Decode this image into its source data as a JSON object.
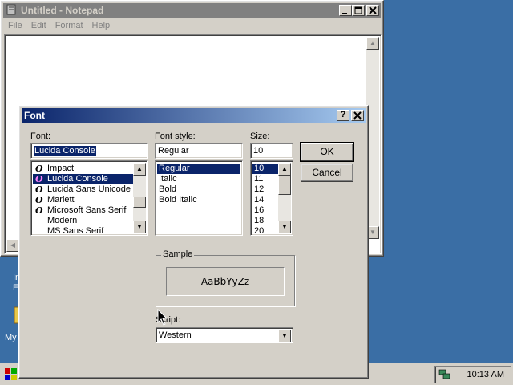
{
  "notepad": {
    "title": "Untitled - Notepad",
    "menu": [
      "File",
      "Edit",
      "Format",
      "Help"
    ]
  },
  "desktop": {
    "icon_label_1": "In",
    "icon_label_2": "Ex",
    "icon_label_3": "My"
  },
  "taskbar": {
    "clock": "10:13 AM"
  },
  "dialog": {
    "title": "Font",
    "help_button": "?",
    "close_button": "✕",
    "font_label": "Font:",
    "font_value": "Lucida Console",
    "font_list": [
      {
        "name": "Impact",
        "type": "opentype",
        "selected": false
      },
      {
        "name": "Lucida Console",
        "type": "opentype",
        "selected": true
      },
      {
        "name": "Lucida Sans Unicode",
        "type": "opentype",
        "selected": false
      },
      {
        "name": "Marlett",
        "type": "opentype",
        "selected": false
      },
      {
        "name": "Microsoft Sans Serif",
        "type": "opentype",
        "selected": false
      },
      {
        "name": "Modern",
        "type": "none",
        "selected": false
      },
      {
        "name": "MS Sans Serif",
        "type": "none",
        "selected": false
      }
    ],
    "style_label": "Font style:",
    "style_value": "Regular",
    "style_list": [
      "Regular",
      "Italic",
      "Bold",
      "Bold Italic"
    ],
    "style_selected": "Regular",
    "size_label": "Size:",
    "size_value": "10",
    "size_list": [
      "10",
      "11",
      "12",
      "14",
      "16",
      "18",
      "20"
    ],
    "size_selected": "10",
    "ok_button": "OK",
    "cancel_button": "Cancel",
    "sample_label": "Sample",
    "sample_text": "AaBbYyZz",
    "script_label": "Script:",
    "script_value": "Western"
  },
  "colors": {
    "desktop": "#3a6ea5",
    "face": "#d4d0c8",
    "active_title_start": "#0a246a",
    "active_title_end": "#a6caf0",
    "inactive_title": "#808080",
    "selection": "#0a246a"
  }
}
